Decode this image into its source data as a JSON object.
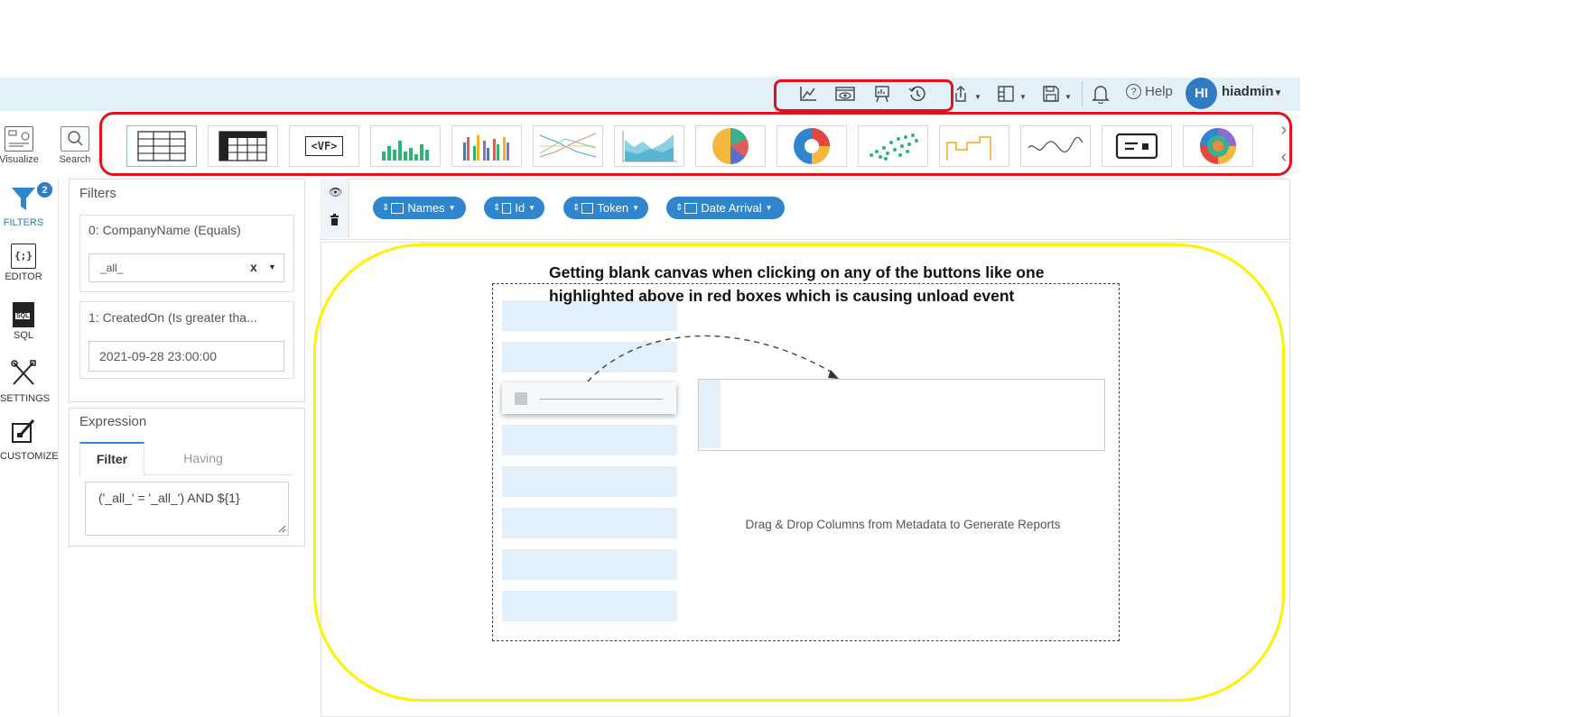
{
  "toolbar": {
    "icons": [
      "line-chart-icon",
      "preview-icon",
      "presentation-icon",
      "history-icon",
      "export-icon",
      "layout-icon",
      "save-icon",
      "bell-icon"
    ],
    "help_label": "Help",
    "avatar_initials": "HI",
    "username": "hiadmin"
  },
  "left_tools": [
    {
      "label": "Visualize",
      "icon": "visualize-icon"
    },
    {
      "label": "Search",
      "icon": "search-icon"
    }
  ],
  "chart_types": [
    {
      "name": "table",
      "vf_label": ""
    },
    {
      "name": "grid",
      "vf_label": ""
    },
    {
      "name": "vf",
      "vf_label": "<VF>"
    },
    {
      "name": "bar",
      "vf_label": ""
    },
    {
      "name": "multi-bar",
      "vf_label": ""
    },
    {
      "name": "scatter-line",
      "vf_label": ""
    },
    {
      "name": "area",
      "vf_label": ""
    },
    {
      "name": "pie",
      "vf_label": ""
    },
    {
      "name": "donut",
      "vf_label": ""
    },
    {
      "name": "scatter",
      "vf_label": ""
    },
    {
      "name": "step",
      "vf_label": ""
    },
    {
      "name": "line",
      "vf_label": ""
    },
    {
      "name": "card",
      "vf_label": ""
    },
    {
      "name": "sunburst",
      "vf_label": ""
    }
  ],
  "nav": {
    "filters_label": "FILTERS",
    "filters_badge": "2",
    "editor_label": "EDITOR",
    "editor_glyph": "{;}",
    "sql_label": "SQL",
    "sql_glyph": "SQL",
    "settings_label": "SETTINGS",
    "customize_label": "CUSTOMIZE"
  },
  "filters": {
    "title": "Filters",
    "items": [
      {
        "label": "0: CompanyName (Equals)",
        "value": "_all_",
        "clear": "x"
      },
      {
        "label": "1: CreatedOn (Is greater tha...",
        "value": "2021-09-28 23:00:00"
      }
    ]
  },
  "expression": {
    "title": "Expression",
    "tabs": [
      "Filter",
      "Having"
    ],
    "active_tab": "Filter",
    "value": "('_all_' = '_all_') AND ${1}"
  },
  "columns": [
    {
      "label": "Names"
    },
    {
      "label": "Id"
    },
    {
      "label": "Token"
    },
    {
      "label": "Date Arrival"
    }
  ],
  "canvas": {
    "annotation": "Getting blank canvas when clicking on any of the buttons like one highlighted above in red boxes which is causing unload event",
    "drag_drop_text": "Drag & Drop Columns from Metadata to Generate Reports"
  },
  "colors": {
    "accent": "#2f86cf",
    "topbar_bg": "#e1f0f9",
    "highlight_red": "#e3121c",
    "highlight_yellow": "#fff200"
  }
}
